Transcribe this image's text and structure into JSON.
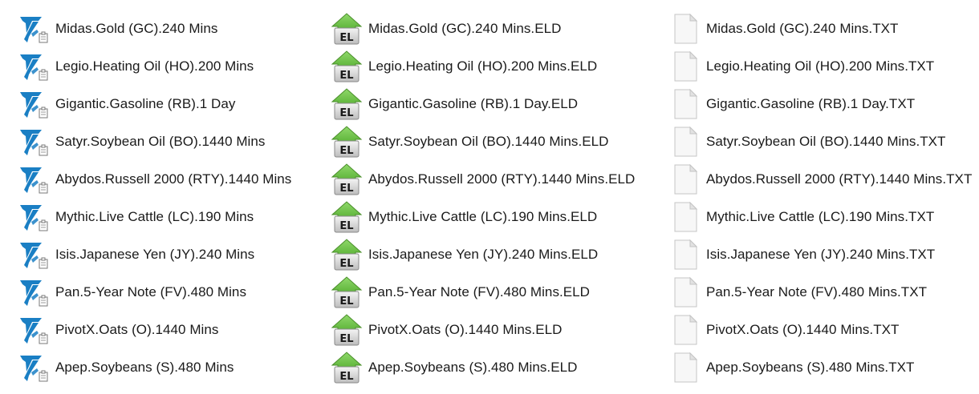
{
  "colors": {
    "ts_blue": "#1a7fc4",
    "eld_green": "#5cb338",
    "eld_gray": "#9a9a9a",
    "text": "#1a1a1a"
  },
  "icons": {
    "ts_file": "tradestation-strategy-icon",
    "eld_file": "easylanguage-eld-icon",
    "txt_file": "text-document-icon"
  },
  "eld_badge": "EL",
  "columns": {
    "ts_files": [
      "Midas.Gold (GC).240 Mins",
      "Legio.Heating Oil (HO).200 Mins",
      "Gigantic.Gasoline (RB).1 Day",
      "Satyr.Soybean Oil (BO).1440 Mins",
      "Abydos.Russell 2000 (RTY).1440 Mins",
      "Mythic.Live Cattle (LC).190 Mins",
      "Isis.Japanese Yen (JY).240 Mins",
      "Pan.5-Year Note (FV).480 Mins",
      "PivotX.Oats (O).1440 Mins",
      "Apep.Soybeans (S).480 Mins"
    ],
    "eld_files": [
      "Midas.Gold (GC).240 Mins.ELD",
      "Legio.Heating Oil (HO).200 Mins.ELD",
      "Gigantic.Gasoline (RB).1 Day.ELD",
      "Satyr.Soybean Oil (BO).1440 Mins.ELD",
      "Abydos.Russell 2000 (RTY).1440 Mins.ELD",
      "Mythic.Live Cattle (LC).190 Mins.ELD",
      "Isis.Japanese Yen (JY).240 Mins.ELD",
      "Pan.5-Year Note (FV).480 Mins.ELD",
      "PivotX.Oats (O).1440 Mins.ELD",
      "Apep.Soybeans (S).480 Mins.ELD"
    ],
    "txt_files": [
      "Midas.Gold (GC).240 Mins.TXT",
      "Legio.Heating Oil (HO).200 Mins.TXT",
      "Gigantic.Gasoline (RB).1 Day.TXT",
      "Satyr.Soybean Oil (BO).1440 Mins.TXT",
      "Abydos.Russell 2000 (RTY).1440 Mins.TXT",
      "Mythic.Live Cattle (LC).190 Mins.TXT",
      "Isis.Japanese Yen (JY).240 Mins.TXT",
      "Pan.5-Year Note (FV).480 Mins.TXT",
      "PivotX.Oats (O).1440 Mins.TXT",
      "Apep.Soybeans (S).480 Mins.TXT"
    ]
  }
}
